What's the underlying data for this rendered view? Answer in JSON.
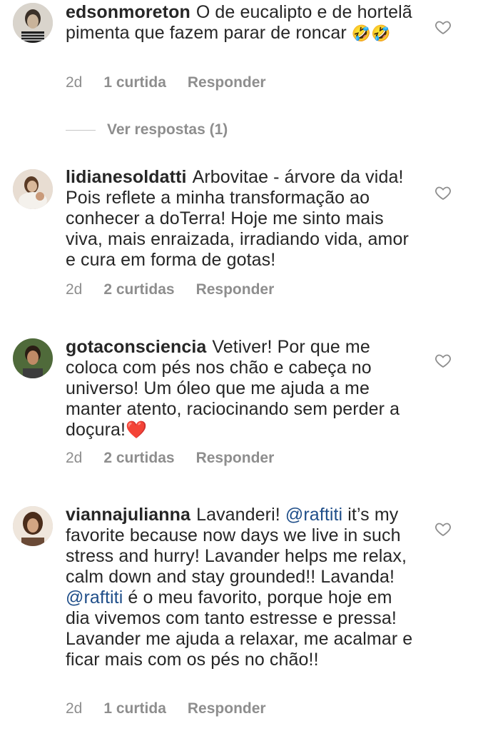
{
  "comments": [
    {
      "username": "edsonmoreton",
      "text": "O de eucalipto e de hortelã pimenta que fazem parar de roncar",
      "emoji": "🤣🤣",
      "age": "2d",
      "likes": "1 curtida",
      "reply_label": "Responder",
      "view_replies": "Ver respostas (1)"
    },
    {
      "username": "lidianesoldatti",
      "text": "Arbovitae - árvore da vida! Pois reflete a minha transformação ao conhecer a doTerra! Hoje me sinto mais viva, mais enraizada, irradiando vida, amor e cura em forma de gotas!",
      "age": "2d",
      "likes": "2 curtidas",
      "reply_label": "Responder"
    },
    {
      "username": "gotaconsciencia",
      "text": "Vetiver! Por que me coloca com pés nos chão e cabeça no universo! Um óleo que me ajuda a me manter atento, raciocinando sem perder a doçura!",
      "emoji": "❤️",
      "age": "2d",
      "likes": "2 curtidas",
      "reply_label": "Responder"
    },
    {
      "username": "viannajulianna",
      "text_1": "Lavanderi!",
      "mention": "@raftiti",
      "text_2": "it’s my favorite because now days we live in such stress and hurry! Lavander helps me relax, calm down and stay grounded!! Lavanda!",
      "text_3": "é o meu favorito, porque hoje em dia vivemos com tanto estresse e pressa!  Lavander me ajuda a relaxar, me acalmar e ficar mais com os pés no chão!!",
      "age": "2d",
      "likes": "1 curtida",
      "reply_label": "Responder"
    }
  ],
  "icons": {
    "like": "heart-outline-icon"
  },
  "colors": {
    "text": "#262626",
    "secondary": "#8e8e8e",
    "mention": "#1f4e89"
  }
}
